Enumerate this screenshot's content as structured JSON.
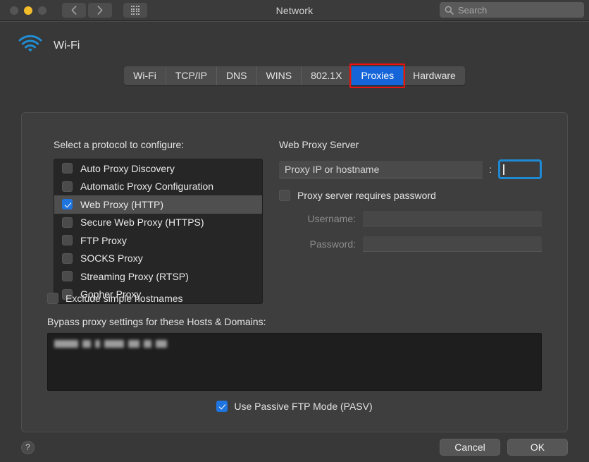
{
  "window": {
    "title": "Network",
    "traffic_lights": [
      "close-button",
      "minimize-button",
      "zoom-button"
    ]
  },
  "toolbar": {
    "back_icon": "chevron-left-icon",
    "forward_icon": "chevron-right-icon",
    "show_all_icon": "grid-icon",
    "search": {
      "icon": "search-icon",
      "placeholder": "Search",
      "value": ""
    }
  },
  "service": {
    "icon": "wifi-icon",
    "name": "Wi-Fi"
  },
  "tabs": [
    {
      "label": "Wi-Fi",
      "selected": false
    },
    {
      "label": "TCP/IP",
      "selected": false
    },
    {
      "label": "DNS",
      "selected": false
    },
    {
      "label": "WINS",
      "selected": false
    },
    {
      "label": "802.1X",
      "selected": false
    },
    {
      "label": "Proxies",
      "selected": true,
      "annotated": true
    },
    {
      "label": "Hardware",
      "selected": false
    }
  ],
  "proxies": {
    "protocol_list_label": "Select a protocol to configure:",
    "protocols": [
      {
        "label": "Auto Proxy Discovery",
        "checked": false,
        "selected": false
      },
      {
        "label": "Automatic Proxy Configuration",
        "checked": false,
        "selected": false
      },
      {
        "label": "Web Proxy (HTTP)",
        "checked": true,
        "selected": true
      },
      {
        "label": "Secure Web Proxy (HTTPS)",
        "checked": false,
        "selected": false
      },
      {
        "label": "FTP Proxy",
        "checked": false,
        "selected": false
      },
      {
        "label": "SOCKS Proxy",
        "checked": false,
        "selected": false
      },
      {
        "label": "Streaming Proxy (RTSP)",
        "checked": false,
        "selected": false
      },
      {
        "label": "Gopher Proxy",
        "checked": false,
        "selected": false
      }
    ],
    "exclude_simple_hostnames": {
      "label": "Exclude simple hostnames",
      "checked": false
    },
    "bypass_label": "Bypass proxy settings for these Hosts & Domains:",
    "bypass_value": "",
    "bypass_redacted": true,
    "passive_ftp": {
      "label": "Use Passive FTP Mode (PASV)",
      "checked": true
    },
    "server": {
      "title": "Web Proxy Server",
      "host_placeholder": "Proxy IP or hostname",
      "host_value": "",
      "separator": ":",
      "port_value": "",
      "port_focused": true,
      "requires_password": {
        "label": "Proxy server requires password",
        "checked": false
      },
      "username_label": "Username:",
      "username_value": "",
      "password_label": "Password:",
      "password_value": ""
    }
  },
  "footer": {
    "help_label": "?",
    "cancel_label": "Cancel",
    "ok_label": "OK"
  },
  "colors": {
    "accent_blue": "#1565d8",
    "checkbox_blue": "#1f75e0",
    "focus_ring": "#1f8ad4",
    "annotation_red": "#ee1111",
    "wifi_icon": "#1f8ad4",
    "window_bg": "#383838",
    "panel_bg": "#3e3e3e",
    "list_bg": "#262626",
    "toolbar_bg": "#3b3b3b",
    "traffic_yellow": "#f3bc2b"
  }
}
